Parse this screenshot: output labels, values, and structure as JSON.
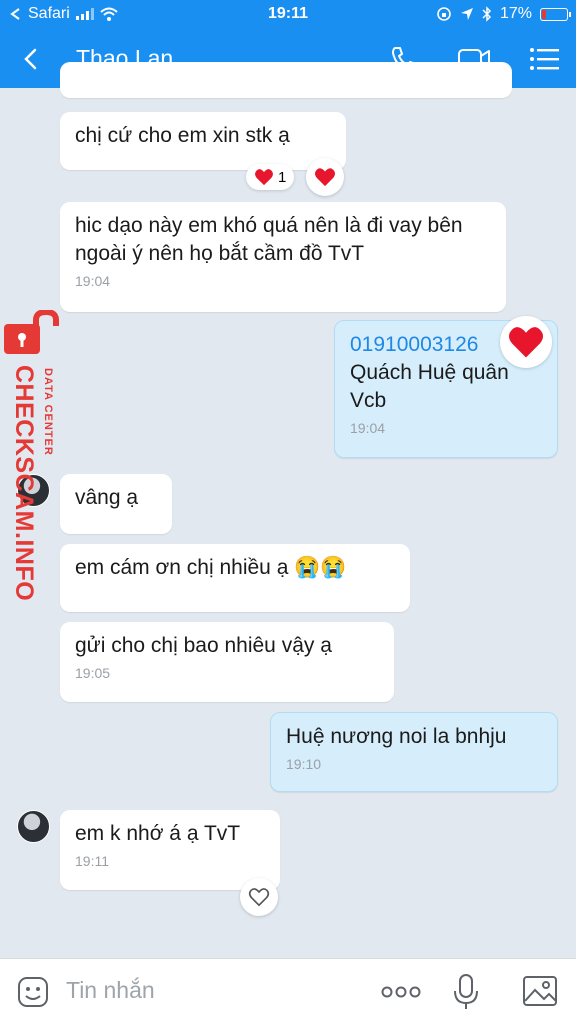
{
  "status": {
    "carrier": "Safari",
    "time": "19:11",
    "battery": "17%",
    "battery_level": 0.17,
    "icons": [
      "back-to-safari-icon",
      "signal-icon",
      "wifi-icon",
      "screen-lock-icon",
      "location-icon",
      "bluetooth-icon",
      "battery-icon"
    ]
  },
  "header": {
    "title": "Thao Lan",
    "icons": [
      "back-arrow-icon",
      "phone-icon",
      "video-call-icon",
      "menu-icon"
    ]
  },
  "messages": [
    {
      "text": "chị cứ cho em xin stk ạ",
      "reaction_count": "1"
    },
    {
      "text": "hic dạo này em khó quá nên là đi vay bên ngoài ý nên họ bắt cầm đồ TvT",
      "time": "19:04"
    },
    {
      "phone": "01910003126",
      "line2": "Quách Huệ quân",
      "line3": "Vcb",
      "time": "19:04"
    },
    {
      "text": "vâng ạ"
    },
    {
      "text": "em cám ơn chị nhiều ạ 😭😭"
    },
    {
      "text": "gửi cho chị bao nhiêu vậy ạ",
      "time": "19:05"
    },
    {
      "text": "Huệ nương noi la bnhju",
      "time": "19:10"
    },
    {
      "text": "em k nhớ á ạ TvT",
      "time": "19:11"
    }
  ],
  "watermark": {
    "brand": "CHECKSCAM.INFO",
    "sub": "DATA CENTER",
    "color": "#e53935"
  },
  "input": {
    "placeholder": "Tin nhắn",
    "icons": [
      "sticker-icon",
      "more-icon",
      "microphone-icon",
      "image-icon"
    ]
  },
  "colors": {
    "accent": "#1a8ff2",
    "heart": "#e8162c",
    "outgoing_bubble": "#d6eefb"
  }
}
